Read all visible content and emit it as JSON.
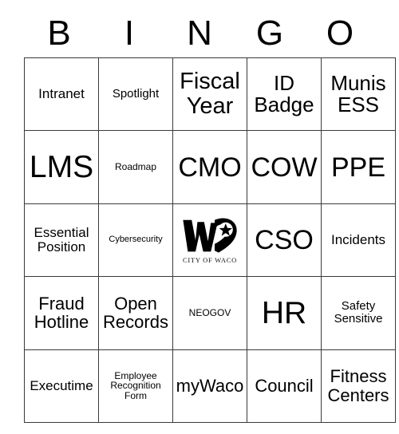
{
  "card": {
    "title": "BINGO Card",
    "header_letters": [
      "B",
      "I",
      "N",
      "G",
      "O"
    ],
    "grid_color": "#3a3a3a",
    "background_color": "#ffffff",
    "text_color": "#000000",
    "rows": 5,
    "columns": 5
  },
  "free_space": {
    "logo_name": "city-of-waco-logo",
    "caption": "CITY OF WACO",
    "logo_color": "#000000"
  },
  "cells": [
    [
      {
        "label": "Intranet",
        "size": "xs"
      },
      {
        "label": "Spotlight",
        "size": "xxs"
      },
      {
        "label": "Fiscal Year",
        "size": "lg"
      },
      {
        "label": "ID Badge",
        "size": "md"
      },
      {
        "label": "Munis ESS",
        "size": "md"
      }
    ],
    [
      {
        "label": "LMS",
        "size": "xxl"
      },
      {
        "label": "Roadmap",
        "size": "tiny"
      },
      {
        "label": "CMO",
        "size": "xl"
      },
      {
        "label": "COW",
        "size": "xl"
      },
      {
        "label": "PPE",
        "size": "xl"
      }
    ],
    [
      {
        "label": "Essential Position",
        "size": "xs"
      },
      {
        "label": "Cybersecurity",
        "size": "micro"
      },
      {
        "label": "",
        "size": "free"
      },
      {
        "label": "CSO",
        "size": "xl"
      },
      {
        "label": "Incidents",
        "size": "xs"
      }
    ],
    [
      {
        "label": "Fraud Hotline",
        "size": "sm"
      },
      {
        "label": "Open Records",
        "size": "sm"
      },
      {
        "label": "NEOGOV",
        "size": "tiny"
      },
      {
        "label": "HR",
        "size": "xxl"
      },
      {
        "label": "Safety Sensitive",
        "size": "xxs"
      }
    ],
    [
      {
        "label": "Executime",
        "size": "xs"
      },
      {
        "label": "Employee Recognition Form",
        "size": "tiny"
      },
      {
        "label": "myWaco",
        "size": "sm"
      },
      {
        "label": "Council",
        "size": "sm"
      },
      {
        "label": "Fitness Centers",
        "size": "sm"
      }
    ]
  ]
}
